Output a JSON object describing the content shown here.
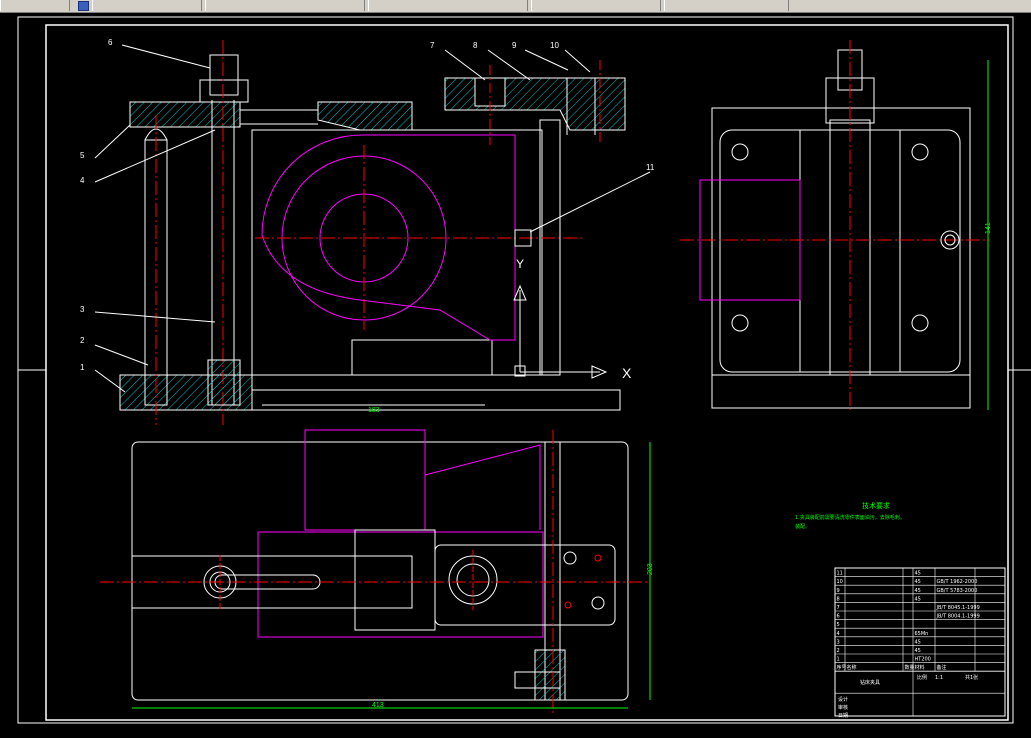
{
  "window": {
    "toolbar_tabs": [
      "",
      "",
      "",
      "",
      "",
      ""
    ]
  },
  "dimensions": {
    "top_view_width": "183",
    "bottom_view_width": "413",
    "bottom_view_height": "203",
    "side_view_height": "141"
  },
  "part_labels": [
    "1",
    "2",
    "3",
    "4",
    "5",
    "6",
    "7",
    "8",
    "9",
    "10",
    "11"
  ],
  "axis_labels": {
    "y": "Y",
    "x": "X"
  },
  "tech_requirements": {
    "title": "技术要求",
    "line1": "1.夹具装配前需要清洗零件表面油污，去除毛刺。",
    "line2": "装配。"
  },
  "bom": {
    "rows": [
      {
        "no": "11",
        "name": "",
        "qty": "",
        "mat": "45",
        "std": ""
      },
      {
        "no": "10",
        "name": "",
        "qty": "",
        "mat": "45",
        "std": "GB/T 1962-2000"
      },
      {
        "no": "9",
        "name": "",
        "qty": "",
        "mat": "45",
        "std": "GB/T 5783-2000"
      },
      {
        "no": "8",
        "name": "",
        "qty": "",
        "mat": "45",
        "std": ""
      },
      {
        "no": "7",
        "name": "",
        "qty": "",
        "mat": "",
        "std": "JB/T 8045.1-1999"
      },
      {
        "no": "6",
        "name": "",
        "qty": "",
        "mat": "",
        "std": "JB/T 8004.1-1999"
      },
      {
        "no": "5",
        "name": "",
        "qty": "",
        "mat": "",
        "std": ""
      },
      {
        "no": "4",
        "name": "",
        "qty": "",
        "mat": "65Mn",
        "std": ""
      },
      {
        "no": "3",
        "name": "",
        "qty": "",
        "mat": "45",
        "std": ""
      },
      {
        "no": "2",
        "name": "",
        "qty": "",
        "mat": "45",
        "std": ""
      },
      {
        "no": "1",
        "name": "",
        "qty": "",
        "mat": "HT200",
        "std": ""
      }
    ],
    "header": {
      "no": "序号",
      "name": "名称",
      "qty": "数量",
      "mat": "材料",
      "std": "备注"
    },
    "title_block": {
      "drawing_name": "钻床夹具",
      "scale_label": "比例",
      "scale": "1:1",
      "sheet": "共1张",
      "designer": "设计",
      "checker": "审核",
      "date": "日期"
    }
  },
  "colors": {
    "background": "#000000",
    "outline": "#ffffff",
    "centerline": "#ff0000",
    "hidden": "#ff00ff",
    "hatch": "#00c8c8",
    "dimension": "#00ff00",
    "text_green": "#00ff00"
  }
}
